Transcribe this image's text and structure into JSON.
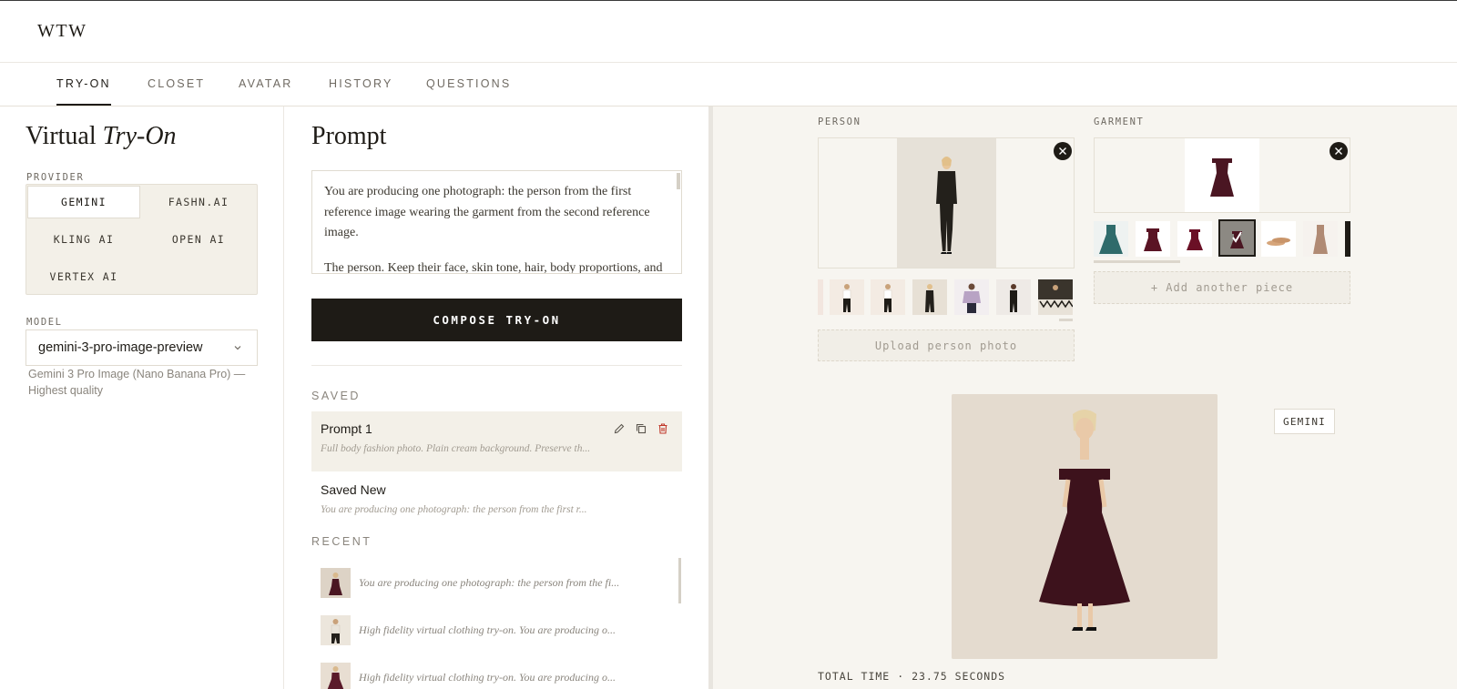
{
  "app": {
    "logo": "WTW"
  },
  "nav": {
    "tabs": [
      {
        "label": "TRY-ON",
        "active": true
      },
      {
        "label": "CLOSET",
        "active": false
      },
      {
        "label": "AVATAR",
        "active": false
      },
      {
        "label": "HISTORY",
        "active": false
      },
      {
        "label": "QUESTIONS",
        "active": false
      }
    ]
  },
  "left": {
    "title_plain": "Virtual",
    "title_italic": "Try-On",
    "provider_label": "PROVIDER",
    "providers": [
      {
        "label": "GEMINI",
        "active": true
      },
      {
        "label": "FASHN.AI",
        "active": false
      },
      {
        "label": "KLING AI",
        "active": false
      },
      {
        "label": "OPEN AI",
        "active": false
      },
      {
        "label": "VERTEX AI",
        "active": false
      }
    ],
    "model_label": "MODEL",
    "model_value": "gemini-3-pro-image-preview",
    "model_description": "Gemini 3 Pro Image (Nano Banana Pro) — Highest quality"
  },
  "middle": {
    "title": "Prompt",
    "prompt_para1": "You are producing one photograph: the person from the first reference image wearing the garment from the second reference image.",
    "prompt_para2": "The person. Keep their face, skin tone, hair, body proportions, and",
    "compose_label": "COMPOSE TRY-ON",
    "saved_label": "SAVED",
    "saved": [
      {
        "name": "Prompt 1",
        "preview": "Full body fashion photo. Plain cream background. Preserve th..."
      },
      {
        "name": "Saved New",
        "preview": "You are producing one photograph: the person from the first r..."
      }
    ],
    "recent_label": "RECENT",
    "recent": [
      {
        "text": "You are producing one photograph: the person from the fi..."
      },
      {
        "text": "High fidelity virtual clothing try-on. You are producing o..."
      },
      {
        "text": "High fidelity virtual clothing try-on. You are producing o..."
      }
    ]
  },
  "right": {
    "person_label": "PERSON",
    "garment_label": "GARMENT",
    "upload_person": "Upload person photo",
    "add_piece": "+ Add another piece",
    "provider_badge": "GEMINI",
    "total_time_label": "TOTAL TIME",
    "total_time_sep": "·",
    "total_time_value": "23.75 SECONDS"
  },
  "colors": {
    "ink": "#1e1b16",
    "cream": "#f3f0e8",
    "panel_bg": "#f7f5f0",
    "burgundy": "#4a1622",
    "delete_red": "#c0392b"
  },
  "icons": [
    "chevron-down-icon",
    "edit-icon",
    "copy-icon",
    "trash-icon",
    "close-icon"
  ]
}
